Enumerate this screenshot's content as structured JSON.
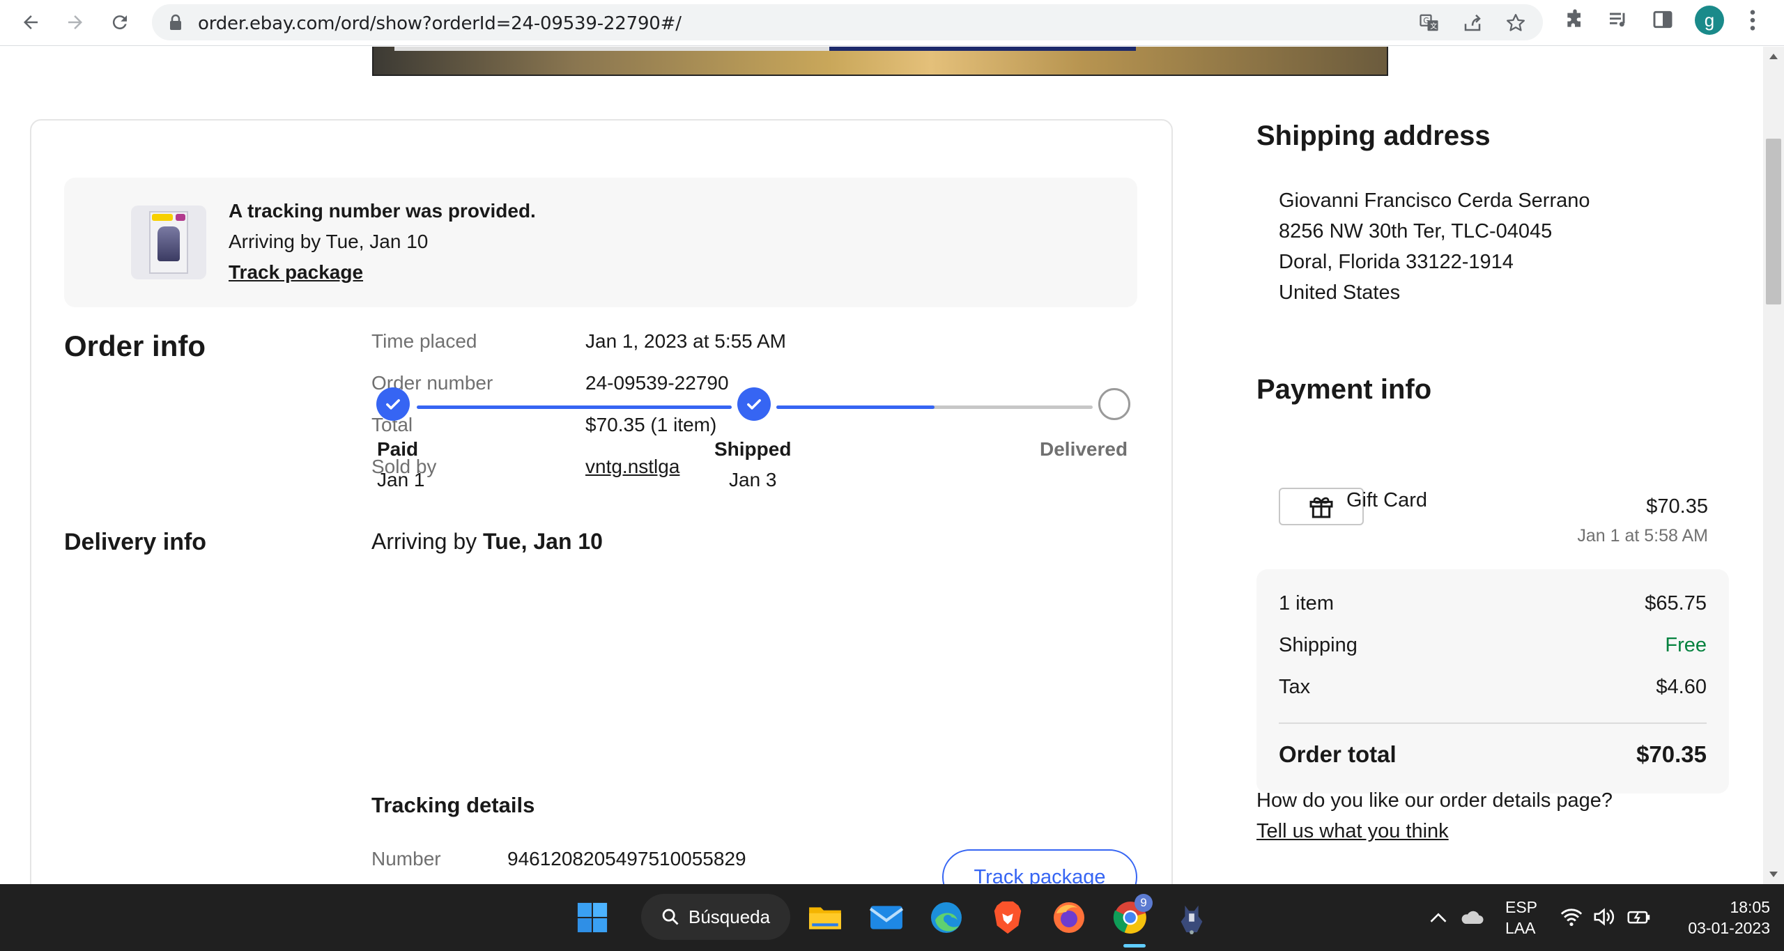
{
  "browser": {
    "url": "order.ebay.com/ord/show?orderId=24-09539-22790#/",
    "profile_initial": "g"
  },
  "notice": {
    "title": "A tracking number was provided.",
    "subtitle": "Arriving by Tue, Jan 10",
    "link": "Track package"
  },
  "order_info": {
    "heading": "Order info",
    "rows": [
      {
        "label": "Time placed",
        "value": "Jan 1, 2023 at 5:55 AM"
      },
      {
        "label": "Order number",
        "value": "24-09539-22790"
      },
      {
        "label": "Total",
        "value": "$70.35 (1 item)"
      },
      {
        "label": "Sold by",
        "value": "vntg.nstlga"
      }
    ]
  },
  "delivery_info": {
    "heading": "Delivery info",
    "arriving_prefix": "Arriving by ",
    "arriving_date": "Tue, Jan 10",
    "progress_fraction": 0.75,
    "steps": [
      {
        "label": "Paid",
        "date": "Jan 1",
        "done": true
      },
      {
        "label": "Shipped",
        "date": "Jan 3",
        "done": true
      },
      {
        "label": "Delivered",
        "date": "",
        "done": false
      }
    ]
  },
  "tracking": {
    "heading": "Tracking details",
    "number_label": "Number",
    "number": "9461208205497510055829",
    "button": "Track package"
  },
  "shipping_address": {
    "heading": "Shipping address",
    "lines": [
      "Giovanni Francisco Cerda Serrano",
      "8256 NW 30th Ter, TLC-04045",
      "Doral, Florida 33122-1914",
      "United States"
    ]
  },
  "payment_info": {
    "heading": "Payment info",
    "method": "Gift Card",
    "amount": "$70.35",
    "date": "Jan 1 at 5:58 AM",
    "summary": [
      {
        "label": "1 item",
        "value": "$65.75"
      },
      {
        "label": "Shipping",
        "value": "Free"
      },
      {
        "label": "Tax",
        "value": "$4.60"
      }
    ],
    "total_label": "Order total",
    "total_value": "$70.35"
  },
  "feedback": {
    "question": "How do you like our order details page?",
    "link": "Tell us what you think"
  },
  "taskbar": {
    "search_label": "Búsqueda",
    "lang_top": "ESP",
    "lang_bottom": "LAA",
    "time": "18:05",
    "date": "03-01-2023",
    "chrome_badge": "9"
  },
  "colors": {
    "ebay_blue": "#3665f3",
    "free_green": "#05823f",
    "taskbar_bg": "#202020"
  },
  "icons": [
    "back-icon",
    "forward-icon",
    "reload-icon",
    "lock-icon",
    "translate-icon",
    "share-icon",
    "star-icon",
    "extensions-icon",
    "media-icon",
    "sidepanel-icon",
    "menu-icon",
    "gift-card-icon",
    "check-icon",
    "windows-start-icon",
    "search-icon",
    "file-explorer-icon",
    "mail-icon",
    "edge-icon",
    "brave-icon",
    "firefox-icon",
    "chrome-icon",
    "app-icon",
    "chevron-up-icon",
    "cloud-icon",
    "wifi-icon",
    "volume-icon",
    "battery-icon"
  ]
}
